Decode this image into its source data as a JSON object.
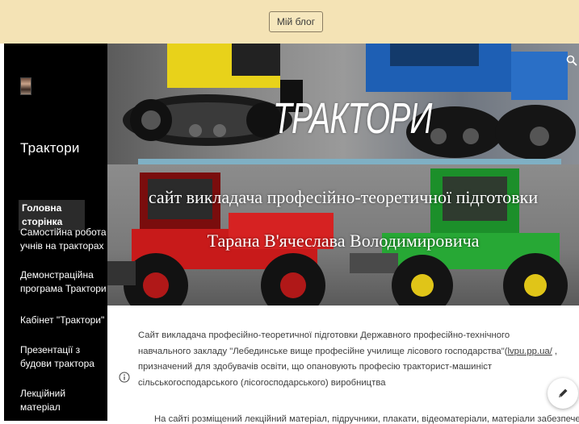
{
  "topbar": {
    "blog_button": "Мій блог"
  },
  "sidebar": {
    "logo_icon": "profile-photo-icon",
    "site_title": "Трактори",
    "nav": [
      {
        "label": "Головна сторінка",
        "active": true
      },
      {
        "label": "Самостійна робота учнів на тракторах",
        "active": false
      },
      {
        "label": "Демонстраційна програма Трактори",
        "active": false
      },
      {
        "label": "Кабінет \"Трактори\"",
        "active": false
      },
      {
        "label": "Презентації з будови трактора",
        "active": false
      },
      {
        "label": "Лекційний матеріал",
        "active": false
      }
    ]
  },
  "hero": {
    "title": "ТРАКТОРИ",
    "subtitle_line1": "сайт викладача професійно-теоретичної підготовки",
    "subtitle_line2": "Тарана В'ячеслава Володимировича",
    "accent_bar_color": "#7fb0c4",
    "search_icon": "search-icon"
  },
  "content": {
    "para_before_link": "Сайт викладача професійно-теоретичної підготовки Державного професійно-технічного навчального закладу \"Лебединське вище професійне училище лісового господарства\"(",
    "link_text": "lvpu.pp.ua/",
    "para_after_link": " , призначений для здобувачів освіти, що опановують професію тракторист-машиніст                              сільськогосподарського (лісогосподарського) виробництва",
    "para2_partial": "На сайті розміщений лекційний матеріал, підручники, плакати, відеоматеріали, матеріали забезпечення",
    "info_icon": "info-icon",
    "edit_icon": "pencil-icon"
  },
  "colors": {
    "topbar_bg": "#f4e3b5",
    "sidebar_bg": "#000000",
    "text": "#3d3d3d"
  }
}
